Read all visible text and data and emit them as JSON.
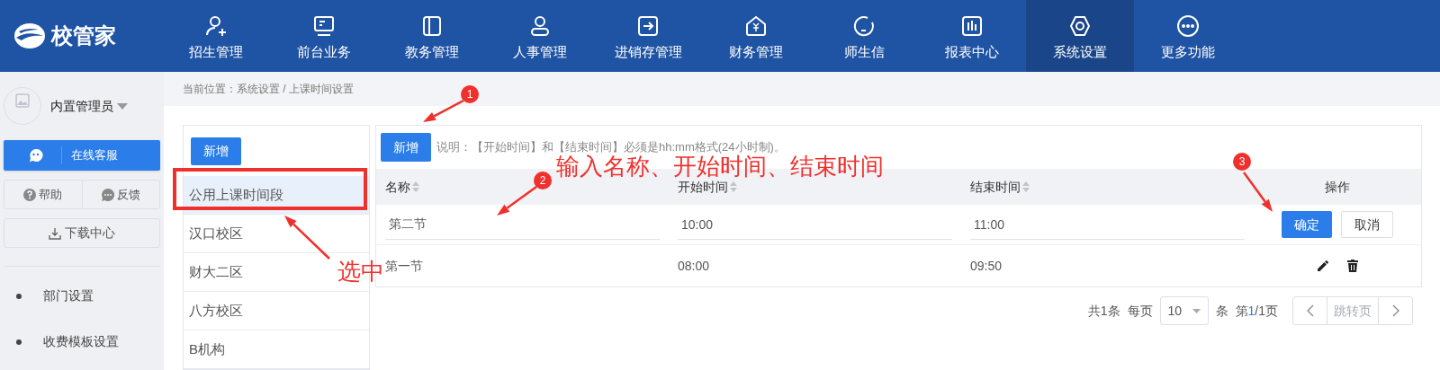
{
  "header": {
    "logo": "校管家",
    "nav": [
      {
        "label": "招生管理",
        "selected": false
      },
      {
        "label": "前台业务",
        "selected": false
      },
      {
        "label": "教务管理",
        "selected": false
      },
      {
        "label": "人事管理",
        "selected": false
      },
      {
        "label": "进销存管理",
        "selected": false
      },
      {
        "label": "财务管理",
        "selected": false
      },
      {
        "label": "师生信",
        "selected": false
      },
      {
        "label": "报表中心",
        "selected": false
      },
      {
        "label": "系统设置",
        "selected": true
      },
      {
        "label": "更多功能",
        "selected": false
      }
    ]
  },
  "sidebar": {
    "user": "内置管理员",
    "service_button": "在线客服",
    "help": "帮助",
    "feedback": "反馈",
    "download": "下载中心",
    "menu": [
      "部门设置",
      "收费模板设置"
    ]
  },
  "breadcrumb": "当前位置：系统设置 / 上课时间设置",
  "campus_panel": {
    "add_button": "新增",
    "items": [
      {
        "label": "公用上课时间段",
        "selected": true
      },
      {
        "label": "汉口校区",
        "selected": false
      },
      {
        "label": "财大二区",
        "selected": false
      },
      {
        "label": "八方校区",
        "selected": false
      },
      {
        "label": "B机构",
        "selected": false
      }
    ]
  },
  "table": {
    "add_button": "新增",
    "note": "说明：【开始时间】和【结束时间】必须是hh:mm格式(24小时制)。",
    "columns": [
      {
        "label": "名称",
        "sortable": true
      },
      {
        "label": "开始时间",
        "sortable": true
      },
      {
        "label": "结束时间",
        "sortable": true
      },
      {
        "label": "操作",
        "sortable": false
      }
    ],
    "rows": [
      {
        "kind": "editing",
        "name": "第二节",
        "start": "10:00",
        "end": "11:00",
        "confirm": "确定",
        "cancel": "取消"
      },
      {
        "kind": "normal",
        "name": "第一节",
        "start": "08:00",
        "end": "09:50"
      }
    ]
  },
  "pagination": {
    "total": "共1条",
    "per_page_label": "每页",
    "per_page": "10",
    "per_page_unit": "条",
    "page_prefix": "第",
    "current_page": "1",
    "page_suffix": "/1页",
    "jump_placeholder": "跳转页"
  },
  "annotations": {
    "markers": [
      "1",
      "2",
      "3"
    ],
    "notes": [
      "输入名称、开始时间、结束时间",
      "选中"
    ]
  }
}
